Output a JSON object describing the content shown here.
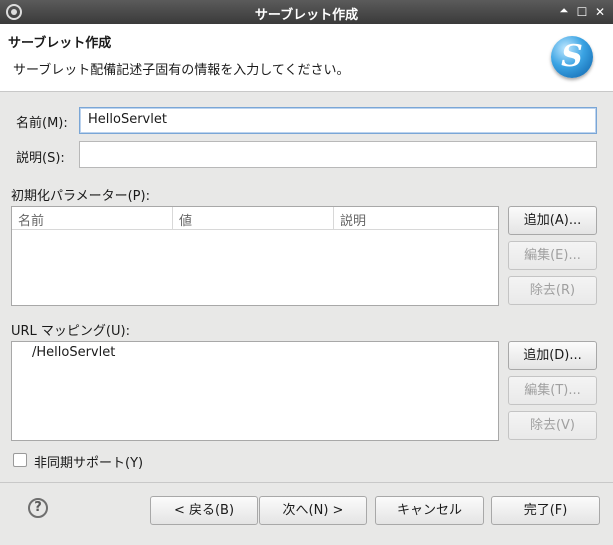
{
  "window": {
    "title": "サーブレット作成",
    "controls": {
      "up": "🞁",
      "maximize": "☐",
      "close": "✕"
    }
  },
  "banner": {
    "title": "サーブレット作成",
    "description": "サーブレット配備記述子固有の情報を入力してください。",
    "logo_letter": "S"
  },
  "form": {
    "name_label": "名前(M):",
    "name_value": "HelloServlet",
    "description_label": "説明(S):",
    "description_value": ""
  },
  "init_params": {
    "label": "初期化パラメーター(P):",
    "columns": [
      "名前",
      "値",
      "説明"
    ],
    "buttons": {
      "add": "追加(A)...",
      "edit": "編集(E)...",
      "remove": "除去(R)"
    }
  },
  "url_mappings": {
    "label": "URL マッピング(U):",
    "items": [
      "/HelloServlet"
    ],
    "buttons": {
      "add": "追加(D)...",
      "edit": "編集(T)...",
      "remove": "除去(V)"
    }
  },
  "async_support": {
    "label": "非同期サポート(Y)",
    "checked": false
  },
  "footer": {
    "help": "?",
    "back": "< 戻る(B)",
    "next": "次へ(N) >",
    "cancel": "キャンセル",
    "finish": "完了(F)"
  }
}
